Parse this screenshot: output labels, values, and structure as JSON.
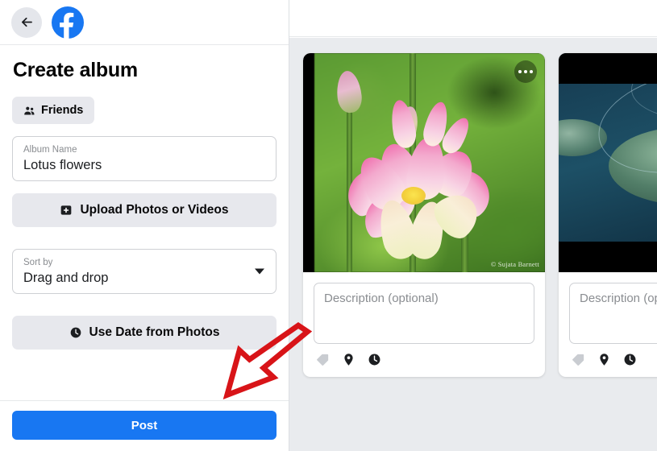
{
  "header": {
    "back_icon": "arrow-left-icon",
    "logo_icon": "facebook-logo-icon"
  },
  "sidebar": {
    "title": "Create album",
    "privacy": {
      "label": "Friends",
      "icon": "friends-people-icon"
    },
    "album_name": {
      "label": "Album Name",
      "value": "Lotus flowers"
    },
    "upload_button": {
      "label": "Upload Photos or Videos",
      "icon": "photo-plus-icon"
    },
    "sort_by": {
      "label": "Sort by",
      "value": "Drag and drop",
      "chevron_icon": "chevron-down-icon"
    },
    "date_button": {
      "label": "Use Date from Photos",
      "icon": "clock-icon"
    },
    "post_button": {
      "label": "Post"
    }
  },
  "main": {
    "cards": [
      {
        "photo_alt": "pink-lotus-flower",
        "menu_icon": "more-options-icon",
        "watermark": "© Sujata Barnett",
        "description_placeholder": "Description (optional)",
        "icons": [
          "tag-icon",
          "location-pin-icon",
          "clock-icon"
        ]
      },
      {
        "photo_alt": "lily-pads-on-water",
        "menu_icon": "more-options-icon",
        "watermark": "",
        "description_placeholder": "Description (optional)",
        "icons": [
          "tag-icon",
          "location-pin-icon",
          "clock-icon"
        ]
      }
    ]
  },
  "annotation": {
    "arrow": "red-arrow-pointing-to-post-button",
    "color": "#d81418"
  },
  "colors": {
    "brand_blue": "#1877f2",
    "chip_grey": "#e7e8ed",
    "canvas_grey": "#e9ebee",
    "text_primary": "#050505",
    "text_secondary": "#8a8d91"
  }
}
